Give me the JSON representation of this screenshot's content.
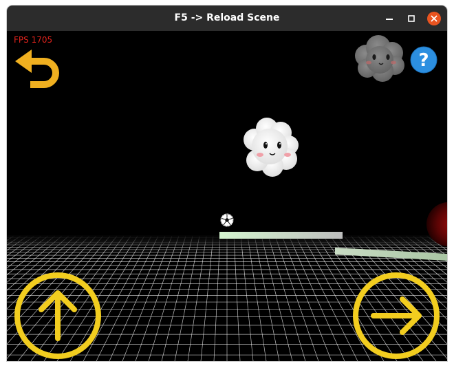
{
  "window": {
    "title": "F5 -> Reload Scene"
  },
  "hud": {
    "fps_label": "FPS 1705",
    "fps_color": "#e0231c"
  },
  "colors": {
    "accent_yellow": "#f2cd1f",
    "back_arrow": "#f0b020",
    "help_blue": "#2c8fe0",
    "close_orange": "#e95420",
    "grid_line": "#ffffff",
    "platform_green": "#d4f5cf"
  },
  "controls": {
    "back_icon": "undo-arrow-icon",
    "help_icon": "question-mark-icon",
    "help_text": "?",
    "jump_icon": "arrow-up-circle-icon",
    "move_icon": "arrow-right-circle-icon"
  }
}
